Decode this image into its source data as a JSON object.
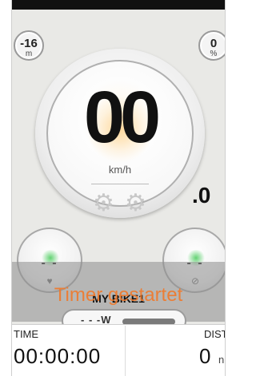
{
  "badges": {
    "altitude": {
      "value": "-16",
      "unit": "m"
    },
    "percent": {
      "value": "0",
      "unit": "%"
    }
  },
  "speedometer": {
    "value": "00",
    "decimal": ".0",
    "unit": "km/h",
    "icons": [
      "cadence-icon",
      "gear-icon"
    ]
  },
  "side_gauges": {
    "heart_rate": {
      "value": "- -",
      "icon": "heart-icon"
    },
    "cadence": {
      "value": "- -",
      "icon": "cadence-icon"
    }
  },
  "toast": {
    "text": "Timer gestartet"
  },
  "bike": {
    "name": "MY BIKE1"
  },
  "power_pill": {
    "text": "- - -W"
  },
  "metrics": {
    "time": {
      "label": "TIME",
      "value": "00:00:00"
    },
    "distance": {
      "label": "DIST",
      "value": "0",
      "unit": "n"
    }
  },
  "colors": {
    "toast": "#f07a2c",
    "gauge_glow": "#ffbe5a",
    "zone_green": "#3cc850"
  }
}
